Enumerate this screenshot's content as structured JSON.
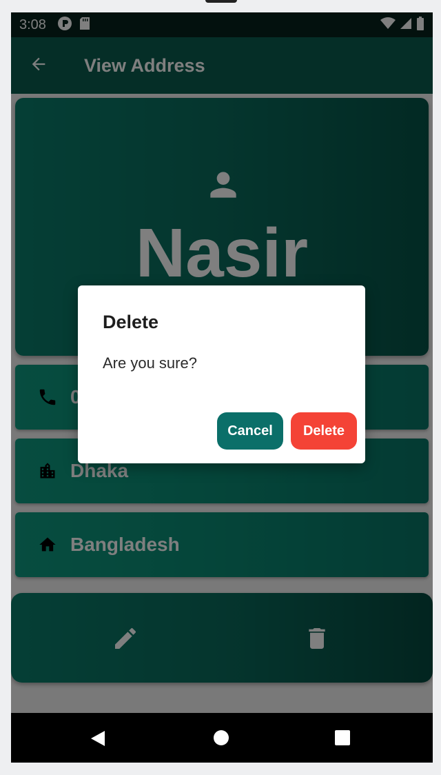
{
  "status_bar": {
    "time": "3:08",
    "left_icons": [
      "pin-app-icon",
      "sd-card-icon"
    ],
    "right_icons": [
      "wifi-icon",
      "signal-icon",
      "battery-icon"
    ]
  },
  "app_bar": {
    "back_icon": "arrow-back-icon",
    "title": "View Address"
  },
  "profile": {
    "icon": "person-icon",
    "name": "Nasir"
  },
  "details": [
    {
      "icon": "phone-icon",
      "value": "0"
    },
    {
      "icon": "city-icon",
      "value": "Dhaka"
    },
    {
      "icon": "home-icon",
      "value": "Bangladesh"
    }
  ],
  "actions": {
    "edit_icon": "edit-icon",
    "delete_icon": "trash-icon"
  },
  "dialog": {
    "title": "Delete",
    "message": "Are you sure?",
    "cancel_label": "Cancel",
    "delete_label": "Delete"
  },
  "colors": {
    "app_bar": "#0a5c4e",
    "card_teal": "#0a8a73",
    "cancel_button": "#0b6f69",
    "delete_button": "#f44336"
  },
  "nav_bar": {
    "icons": [
      "nav-back-icon",
      "nav-home-icon",
      "nav-recents-icon"
    ]
  }
}
